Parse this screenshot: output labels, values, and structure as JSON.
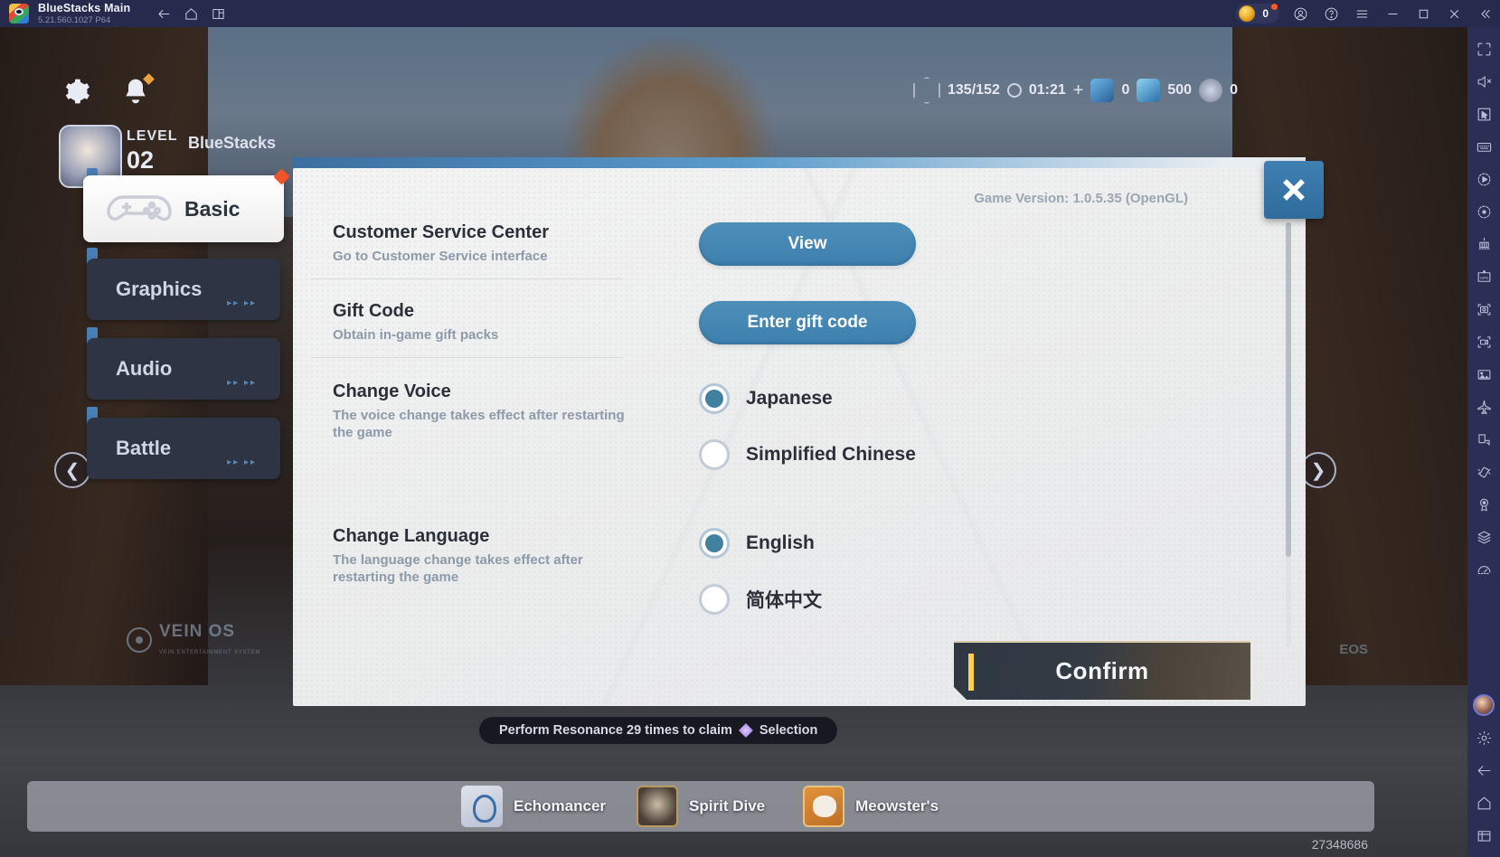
{
  "titlebar": {
    "app_name": "BlueStacks Main",
    "version": "5.21.560.1027  P64",
    "icons": [
      "back-arrow-icon",
      "home-icon",
      "multi-instance-icon"
    ],
    "coin_count": "0",
    "right_icons": [
      "account-icon",
      "help-icon",
      "menu-icon",
      "minimize-icon",
      "maximize-icon",
      "close-icon",
      "collapse-icon"
    ]
  },
  "right_sidebar": {
    "items": [
      {
        "name": "fullscreen-icon"
      },
      {
        "name": "mute-icon"
      },
      {
        "name": "cursor-icon"
      },
      {
        "name": "keyboard-controls-icon"
      },
      {
        "name": "macro-record-icon"
      },
      {
        "name": "rewind-icon"
      },
      {
        "name": "multi-instance-manager-icon"
      },
      {
        "name": "install-apk-icon"
      },
      {
        "name": "screenshot-icon"
      },
      {
        "name": "screen-record-icon"
      },
      {
        "name": "media-manager-icon"
      },
      {
        "name": "airplane-mode-icon"
      },
      {
        "name": "rotate-icon"
      },
      {
        "name": "shake-icon"
      },
      {
        "name": "location-icon"
      },
      {
        "name": "layers-icon"
      },
      {
        "name": "performance-icon"
      }
    ],
    "bottom_items": [
      {
        "name": "profile-avatar"
      },
      {
        "name": "settings-gear-icon"
      },
      {
        "name": "back-arrow-icon"
      },
      {
        "name": "home-icon"
      },
      {
        "name": "recents-icon"
      }
    ]
  },
  "game_hud": {
    "gear_icon": "settings-gear-icon",
    "bell_icon": "notification-bell-icon",
    "level_label": "LEVEL",
    "level_value": "02",
    "player_name": "BlueStacks",
    "stamina": "135/152",
    "timer": "01:21",
    "currency_1": "0",
    "currency_2": "500",
    "currency_3": "0",
    "toast": "Perform Resonance 29 times to claim",
    "toast_tail": "Selection",
    "nav": [
      {
        "label": "Echomancer",
        "icon": "echomancer-icon"
      },
      {
        "label": "Spirit Dive",
        "icon": "spirit-dive-icon"
      },
      {
        "label": "Meowster's",
        "icon": "meowsters-icon"
      }
    ],
    "uid": "27348686",
    "watermark": "VEIN OS",
    "watermark_sub": "VEIN ENTERTAINMENT SYSTEM",
    "watermark_right": "EOS"
  },
  "dialog": {
    "game_version": "Game Version: 1.0.5.35 (OpenGL)",
    "close_icon": "close-icon",
    "tabs": [
      {
        "label": "Basic",
        "active": true,
        "icon": "gamepad-icon",
        "badge": true
      },
      {
        "label": "Graphics",
        "active": false,
        "chevrons": "▸▸ ▸▸"
      },
      {
        "label": "Audio",
        "active": false,
        "chevrons": "▸▸ ▸▸"
      },
      {
        "label": "Battle",
        "active": false,
        "chevrons": "▸▸ ▸▸"
      }
    ],
    "settings": [
      {
        "title": "Customer Service Center",
        "desc": "Go to Customer Service interface",
        "control": "button",
        "button_label": "View"
      },
      {
        "title": "Gift Code",
        "desc": "Obtain in-game gift packs",
        "control": "button",
        "button_label": "Enter gift code"
      },
      {
        "title": "Change Voice",
        "desc": "The voice change takes effect after restarting the game",
        "control": "radio",
        "options": [
          {
            "label": "Japanese",
            "selected": true
          },
          {
            "label": "Simplified Chinese",
            "selected": false
          }
        ]
      },
      {
        "title": "Change Language",
        "desc": "The language change takes effect after restarting the game",
        "control": "radio",
        "options": [
          {
            "label": "English",
            "selected": true
          },
          {
            "label": "简体中文",
            "selected": false
          }
        ]
      }
    ],
    "confirm_label": "Confirm"
  },
  "colors": {
    "accent_blue": "#41809f",
    "titlebar_bg": "#262a4d",
    "sidebar_bg": "#2b2f55",
    "button_blue": "#3d7fae",
    "confirm_yellow": "#ffd24a",
    "badge_red": "#f1542a"
  }
}
